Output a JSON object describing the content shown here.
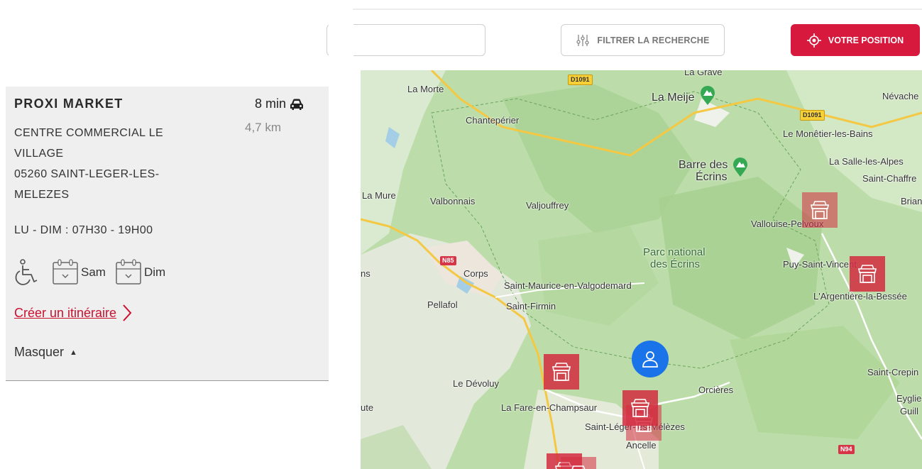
{
  "store": {
    "name": "PROXI MARKET",
    "drive_time": "8 min",
    "distance": "4,7 km",
    "address_lines": [
      "CENTRE COMMERCIAL LE",
      "VILLAGE",
      "05260 SAINT-LEGER-LES-",
      "MELEZES"
    ],
    "hours": "LU - DIM : 07H30 - 19H00",
    "open_days": [
      "Sam",
      "Dim"
    ],
    "route_link": "Créer un itinéraire",
    "toggle_label": "Masquer",
    "icons": [
      "car-icon",
      "wheelchair-icon",
      "calendar-icon",
      "chevron-right-icon",
      "triangle-up-icon"
    ]
  },
  "toolbar": {
    "search_value": "",
    "filter_label": "FILTRER LA RECHERCHE",
    "position_label": "VOTRE POSITION",
    "icons": [
      "sliders-icon",
      "crosshair-icon"
    ]
  },
  "map": {
    "labels": {
      "la_grave": "La Grave",
      "la_morte": "La Morte",
      "la_meije": "La Meije",
      "nevache": "Névache",
      "chantepierre": "Chantepérier",
      "monetier": "Le Monêtier-les-Bains",
      "salle_les_alpes": "La Salle-les-Alpes",
      "saint_chaffrey": "Saint-Chaffre",
      "barre_des_ecrins_1": "Barre des",
      "barre_des_ecrins_2": "Écrins",
      "la_mure": "La Mure",
      "valbonnais": "Valbonnais",
      "valjouffrey": "Valjouffrey",
      "briancon": "Brian",
      "vallouise": "Vallouise-Pelvoux",
      "parc_1": "Parc national",
      "parc_2": "des Écrins",
      "puy_saint_vincent": "Puy-Saint-Vincent",
      "corps": "Corps",
      "ns": "ns",
      "saint_maurice": "Saint-Maurice-en-Valgodemard",
      "argentiere": "L'Argentière-la-Bessée",
      "pellafol": "Pellafol",
      "saint_firmin": "Saint-Firmin",
      "saint_crepin": "Saint-Crepin",
      "le_devoluy": "Le Dévoluy",
      "orcieres": "Orcières",
      "eygliers": "Eyglie",
      "guillestre": "Guill",
      "ute": "ute",
      "la_fare": "La Fare-en-Champsaur",
      "saint_leger": "Saint-Léger-les-Mélèzes",
      "ancelle": "Ancelle"
    },
    "roads": {
      "d1091_a": "D1091",
      "d1091_b": "D1091",
      "n85": "N85",
      "n94": "N94"
    },
    "icons": [
      "store-icon",
      "user-icon",
      "mountain-peak-icon"
    ],
    "colors": {
      "marker": "#d42c40",
      "user": "#1a73e8",
      "park": "#c5e3b3"
    }
  }
}
